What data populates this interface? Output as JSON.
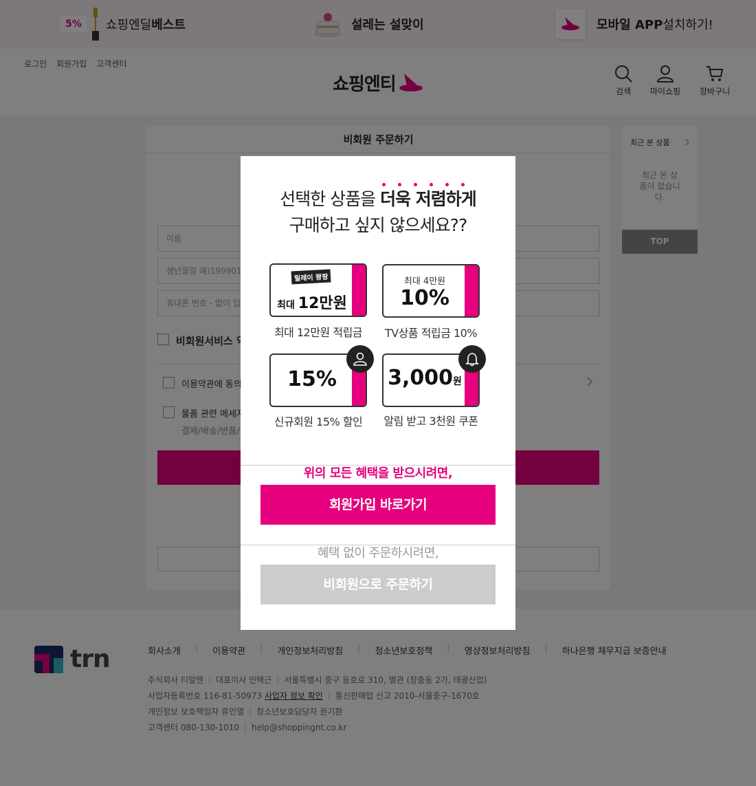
{
  "promo": {
    "item1": {
      "badge": "5%",
      "text_light": "쇼핑엔딜 ",
      "text_bold": "베스트"
    },
    "item2": {
      "text_bold": "설레는 설맞이"
    },
    "item3": {
      "text_bold": "모바일 APP ",
      "text_light": "설치하기!"
    }
  },
  "header": {
    "util_links": [
      "로그인",
      "회원가입",
      "고객센터"
    ],
    "logo": "쇼핑엔티",
    "icons": {
      "search": "검색",
      "my": "마이쇼핑",
      "cart": "장바구니"
    }
  },
  "panel": {
    "title": "비회원 주문하기",
    "fields": {
      "name_placeholder": "이름",
      "birth_placeholder": "생년월일 예)199901",
      "phone_placeholder": "휴대폰 번호 - 없이 입"
    },
    "agree_all": "비회원서비스 약",
    "terms": "이용약관에 동의",
    "msg": "물품 관련 메세지",
    "msg_sub": "결제/배송/반품/"
  },
  "recent": {
    "title": "최근 본 상품",
    "empty": "최근 본 상품이 없습니다.",
    "top": "TOP"
  },
  "footer": {
    "logo": "trn",
    "links": [
      "회사소개",
      "이용약관",
      "개인정보처리방침",
      "청소년보호정책",
      "영상정보처리방침",
      "하나은행 채무지급 보증안내"
    ],
    "info": {
      "company": "주식회사 티알엔",
      "ceo": "대표이사 민택근",
      "address": "서울특별시 중구 동호로 310, 별관 (장충동 2가, 태광산업)",
      "biz_no": "사업자등록번호 116-81-50973",
      "biz_link": "사업자 정보 확인",
      "mail_order": "통신판매업 신고 2010-서울중구-1670호",
      "privacy_officer": "개인정보 보호책임자 류인열",
      "youth_officer": "청소년보호담당자 권기환",
      "cs": "고객센터 080-130-1010",
      "email": "help@shoppingnt.co.kr"
    }
  },
  "modal": {
    "title_line1_light": "선택한 상품을 ",
    "title_line1_bold": "더욱 저렴하게",
    "title_line2": "구매하고 싶지 않으세요??",
    "cards": [
      {
        "relay": "릴레이 꽝팡",
        "prefix": "최대 ",
        "big": "12만원",
        "label": "최대 12만원 적립금"
      },
      {
        "small": "최대 4만원",
        "big": "10%",
        "label": "TV상품 적립금 10%"
      },
      {
        "big": "15%",
        "label": "신규회원 15% 할인"
      },
      {
        "big": "3,000",
        "unit": "원",
        "label": "알림 받고 3천원 쿠폰"
      }
    ],
    "cta_text": "위의 모든 혜택을 받으시려면,",
    "join_button": "회원가입 바로가기",
    "alt_text": "혜택 없이 주문하시려면,",
    "guest_button": "비회원으로 주문하기"
  },
  "colors": {
    "accent": "#e6007e",
    "dim": "rgba(0,0,0,0.5)",
    "guest_button": "#cccccc"
  }
}
